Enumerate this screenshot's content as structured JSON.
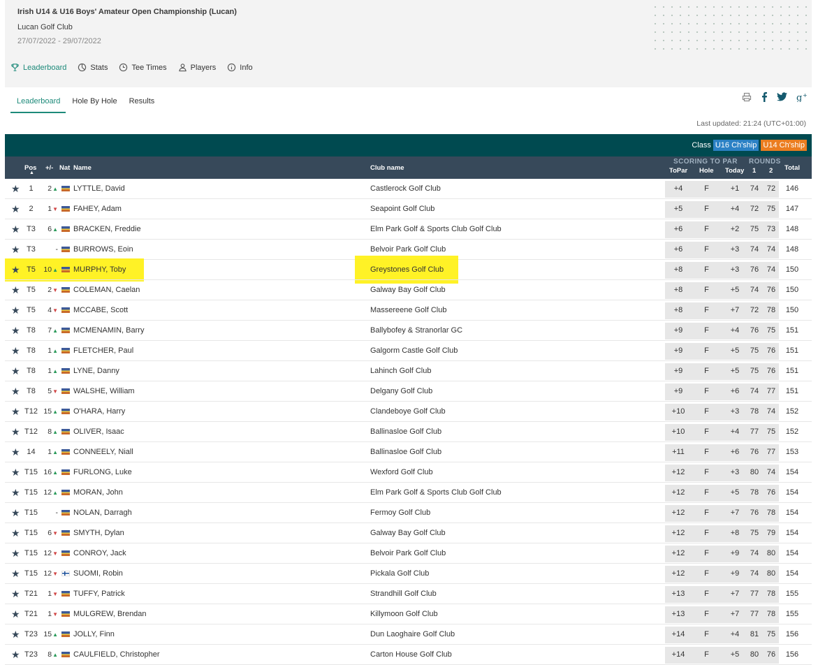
{
  "event": {
    "title": "Irish U14 & U16 Boys' Amateur Open Championship (Lucan)",
    "venue": "Lucan Golf Club",
    "dates": "27/07/2022 - 29/07/2022"
  },
  "nav": [
    {
      "label": "Leaderboard",
      "icon": "trophy-icon",
      "active": true
    },
    {
      "label": "Stats",
      "icon": "pie-chart-icon",
      "active": false
    },
    {
      "label": "Tee Times",
      "icon": "clock-icon",
      "active": false
    },
    {
      "label": "Players",
      "icon": "person-icon",
      "active": false
    },
    {
      "label": "Info",
      "icon": "info-icon",
      "active": false
    }
  ],
  "subtabs": [
    {
      "label": "Leaderboard",
      "active": true
    },
    {
      "label": "Hole By Hole",
      "active": false
    },
    {
      "label": "Results",
      "active": false
    }
  ],
  "share_icons": [
    "print-icon",
    "facebook-icon",
    "twitter-icon",
    "google-plus-icon"
  ],
  "last_updated": "Last updated: 21:24 (UTC+01:00)",
  "class_filter": {
    "label": "Class",
    "badges": [
      {
        "label": "U16 Ch'ship",
        "color": "#2b81c5"
      },
      {
        "label": "U14 Ch'ship",
        "color": "#eb7d1f"
      }
    ]
  },
  "columns": {
    "pos": "Pos",
    "move": "+/-",
    "nat": "Nat",
    "name": "Name",
    "club": "Club name",
    "scoring_group": "SCORING TO PAR",
    "rounds_group": "ROUNDS",
    "topar": "ToPar",
    "hole": "Hole",
    "today": "Today",
    "r1": "1",
    "r2": "2",
    "total": "Total"
  },
  "highlight_color": "#fff000",
  "players": [
    {
      "pos": "1",
      "move": "2",
      "dir": "up",
      "nat": "IRL",
      "name": "LYTTLE, David",
      "club": "Castlerock Golf Club",
      "topar": "+4",
      "hole": "F",
      "today": "+1",
      "r1": "74",
      "r2": "72",
      "total": "146",
      "highlighted": false
    },
    {
      "pos": "2",
      "move": "1",
      "dir": "down",
      "nat": "IRL",
      "name": "FAHEY, Adam",
      "club": "Seapoint Golf Club",
      "topar": "+5",
      "hole": "F",
      "today": "+4",
      "r1": "72",
      "r2": "75",
      "total": "147",
      "highlighted": false
    },
    {
      "pos": "T3",
      "move": "6",
      "dir": "up",
      "nat": "IRL",
      "name": "BRACKEN, Freddie",
      "club": "Elm Park Golf & Sports Club Golf Club",
      "topar": "+6",
      "hole": "F",
      "today": "+2",
      "r1": "75",
      "r2": "73",
      "total": "148",
      "highlighted": false
    },
    {
      "pos": "T3",
      "move": "-",
      "dir": "none",
      "nat": "IRL",
      "name": "BURROWS, Eoin",
      "club": "Belvoir Park Golf Club",
      "topar": "+6",
      "hole": "F",
      "today": "+3",
      "r1": "74",
      "r2": "74",
      "total": "148",
      "highlighted": false
    },
    {
      "pos": "T5",
      "move": "10",
      "dir": "up",
      "nat": "IRL",
      "name": "MURPHY, Toby",
      "club": "Greystones Golf Club",
      "topar": "+8",
      "hole": "F",
      "today": "+3",
      "r1": "76",
      "r2": "74",
      "total": "150",
      "highlighted": true
    },
    {
      "pos": "T5",
      "move": "2",
      "dir": "down",
      "nat": "IRL",
      "name": "COLEMAN, Caelan",
      "club": "Galway Bay Golf Club",
      "topar": "+8",
      "hole": "F",
      "today": "+5",
      "r1": "74",
      "r2": "76",
      "total": "150",
      "highlighted": false
    },
    {
      "pos": "T5",
      "move": "4",
      "dir": "down",
      "nat": "IRL",
      "name": "MCCABE, Scott",
      "club": "Massereene Golf Club",
      "topar": "+8",
      "hole": "F",
      "today": "+7",
      "r1": "72",
      "r2": "78",
      "total": "150",
      "highlighted": false
    },
    {
      "pos": "T8",
      "move": "7",
      "dir": "up",
      "nat": "IRL",
      "name": "MCMENAMIN, Barry",
      "club": "Ballybofey & Stranorlar GC",
      "topar": "+9",
      "hole": "F",
      "today": "+4",
      "r1": "76",
      "r2": "75",
      "total": "151",
      "highlighted": false
    },
    {
      "pos": "T8",
      "move": "1",
      "dir": "up",
      "nat": "IRL",
      "name": "FLETCHER, Paul",
      "club": "Galgorm Castle Golf Club",
      "topar": "+9",
      "hole": "F",
      "today": "+5",
      "r1": "75",
      "r2": "76",
      "total": "151",
      "highlighted": false
    },
    {
      "pos": "T8",
      "move": "1",
      "dir": "up",
      "nat": "IRL",
      "name": "LYNE, Danny",
      "club": "Lahinch Golf Club",
      "topar": "+9",
      "hole": "F",
      "today": "+5",
      "r1": "75",
      "r2": "76",
      "total": "151",
      "highlighted": false
    },
    {
      "pos": "T8",
      "move": "5",
      "dir": "down",
      "nat": "IRL",
      "name": "WALSHE, William",
      "club": "Delgany Golf Club",
      "topar": "+9",
      "hole": "F",
      "today": "+6",
      "r1": "74",
      "r2": "77",
      "total": "151",
      "highlighted": false
    },
    {
      "pos": "T12",
      "move": "15",
      "dir": "up",
      "nat": "IRL",
      "name": "O'HARA, Harry",
      "club": "Clandeboye Golf Club",
      "topar": "+10",
      "hole": "F",
      "today": "+3",
      "r1": "78",
      "r2": "74",
      "total": "152",
      "highlighted": false
    },
    {
      "pos": "T12",
      "move": "8",
      "dir": "up",
      "nat": "IRL",
      "name": "OLIVER, Isaac",
      "club": "Ballinasloe Golf Club",
      "topar": "+10",
      "hole": "F",
      "today": "+4",
      "r1": "77",
      "r2": "75",
      "total": "152",
      "highlighted": false
    },
    {
      "pos": "14",
      "move": "1",
      "dir": "up",
      "nat": "IRL",
      "name": "CONNEELY, Niall",
      "club": "Ballinasloe Golf Club",
      "topar": "+11",
      "hole": "F",
      "today": "+6",
      "r1": "76",
      "r2": "77",
      "total": "153",
      "highlighted": false
    },
    {
      "pos": "T15",
      "move": "16",
      "dir": "up",
      "nat": "IRL",
      "name": "FURLONG, Luke",
      "club": "Wexford Golf Club",
      "topar": "+12",
      "hole": "F",
      "today": "+3",
      "r1": "80",
      "r2": "74",
      "total": "154",
      "highlighted": false
    },
    {
      "pos": "T15",
      "move": "12",
      "dir": "up",
      "nat": "IRL",
      "name": "MORAN, John",
      "club": "Elm Park Golf & Sports Club Golf Club",
      "topar": "+12",
      "hole": "F",
      "today": "+5",
      "r1": "78",
      "r2": "76",
      "total": "154",
      "highlighted": false
    },
    {
      "pos": "T15",
      "move": "-",
      "dir": "none",
      "nat": "IRL",
      "name": "NOLAN, Darragh",
      "club": "Fermoy Golf Club",
      "topar": "+12",
      "hole": "F",
      "today": "+7",
      "r1": "76",
      "r2": "78",
      "total": "154",
      "highlighted": false
    },
    {
      "pos": "T15",
      "move": "6",
      "dir": "down",
      "nat": "IRL",
      "name": "SMYTH, Dylan",
      "club": "Galway Bay Golf Club",
      "topar": "+12",
      "hole": "F",
      "today": "+8",
      "r1": "75",
      "r2": "79",
      "total": "154",
      "highlighted": false
    },
    {
      "pos": "T15",
      "move": "12",
      "dir": "down",
      "nat": "IRL",
      "name": "CONROY, Jack",
      "club": "Belvoir Park Golf Club",
      "topar": "+12",
      "hole": "F",
      "today": "+9",
      "r1": "74",
      "r2": "80",
      "total": "154",
      "highlighted": false
    },
    {
      "pos": "T15",
      "move": "12",
      "dir": "down",
      "nat": "FIN",
      "name": "SUOMI, Robin",
      "club": "Pickala Golf Club",
      "topar": "+12",
      "hole": "F",
      "today": "+9",
      "r1": "74",
      "r2": "80",
      "total": "154",
      "highlighted": false
    },
    {
      "pos": "T21",
      "move": "1",
      "dir": "down",
      "nat": "IRL",
      "name": "TUFFY, Patrick",
      "club": "Strandhill Golf Club",
      "topar": "+13",
      "hole": "F",
      "today": "+7",
      "r1": "77",
      "r2": "78",
      "total": "155",
      "highlighted": false
    },
    {
      "pos": "T21",
      "move": "1",
      "dir": "down",
      "nat": "IRL",
      "name": "MULGREW, Brendan",
      "club": "Killymoon Golf Club",
      "topar": "+13",
      "hole": "F",
      "today": "+7",
      "r1": "77",
      "r2": "78",
      "total": "155",
      "highlighted": false
    },
    {
      "pos": "T23",
      "move": "15",
      "dir": "up",
      "nat": "IRL",
      "name": "JOLLY, Finn",
      "club": "Dun Laoghaire Golf Club",
      "topar": "+14",
      "hole": "F",
      "today": "+4",
      "r1": "81",
      "r2": "75",
      "total": "156",
      "highlighted": false
    },
    {
      "pos": "T23",
      "move": "8",
      "dir": "up",
      "nat": "IRL",
      "name": "CAULFIELD, Christopher",
      "club": "Carton House Golf Club",
      "topar": "+14",
      "hole": "F",
      "today": "+5",
      "r1": "80",
      "r2": "76",
      "total": "156",
      "highlighted": false
    }
  ]
}
